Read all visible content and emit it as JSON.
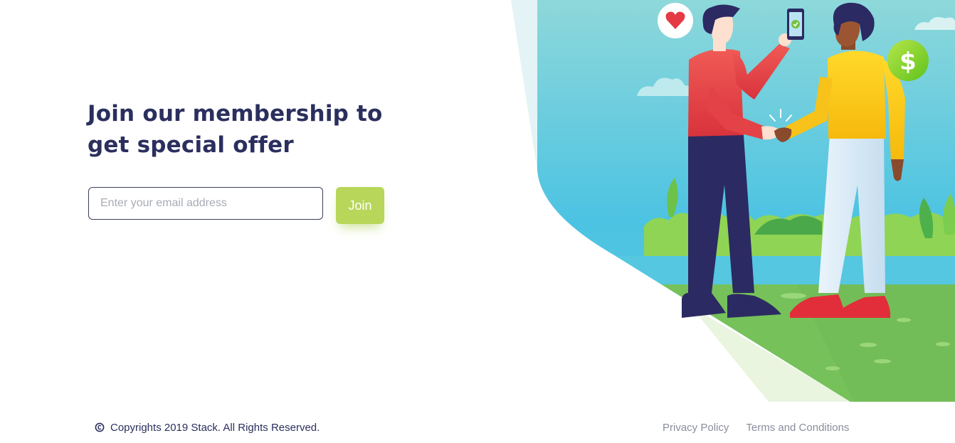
{
  "membership": {
    "heading_line1": "Join our membership to",
    "heading_line2": "get special offer",
    "email_placeholder": "Enter your email address",
    "email_value": "",
    "join_label": "Join"
  },
  "illustration": {
    "icons": [
      "heart-icon",
      "phone-check-icon",
      "dollar-icon"
    ],
    "dollar_symbol": "$"
  },
  "footer": {
    "copyright_text": "Copyrights 2019 Stack. All Rights Reserved.",
    "links": [
      "Privacy Policy",
      "Terms and Conditions"
    ]
  },
  "colors": {
    "heading": "#2b2f5e",
    "accent": "#b8d65a",
    "link": "#8a8d9c",
    "sky": "#6fd0dc",
    "grass": "#76c15a"
  }
}
